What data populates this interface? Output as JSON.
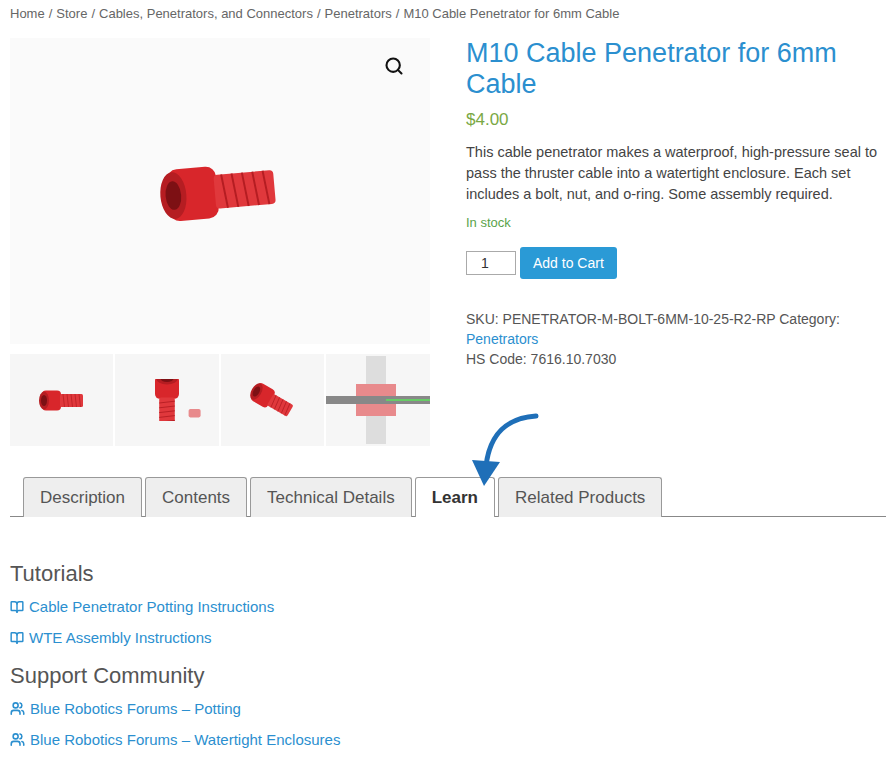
{
  "breadcrumb": {
    "separator": "/",
    "items": [
      "Home",
      "Store",
      "Cables, Penetrators, and Connectors",
      "Penetrators",
      "M10 Cable Penetrator for 6mm Cable"
    ]
  },
  "gallery": {
    "thumbnails": [
      {
        "kind": "bolt"
      },
      {
        "kind": "bolt-nut"
      },
      {
        "kind": "bolt-angle"
      },
      {
        "kind": "cross-section"
      }
    ]
  },
  "product": {
    "title": "M10 Cable Penetrator for 6mm Cable",
    "price": "$4.00",
    "description": "This cable penetrator makes a waterproof, high-pressure seal to pass the thruster cable into a watertight enclosure. Each set includes a bolt, nut, and o-ring. Some assembly required.",
    "stock": "In stock",
    "quantity": "1",
    "button": "Add to Cart",
    "sku_label": "SKU:",
    "sku": "PENETRATOR-M-BOLT-6MM-10-25-R2-RP",
    "category_label": "Category:",
    "category": "Penetrators",
    "hs_label": "HS Code:",
    "hs_code": "7616.10.7030"
  },
  "tabs": [
    {
      "label": "Description",
      "selected": false
    },
    {
      "label": "Contents",
      "selected": false
    },
    {
      "label": "Technical Details",
      "selected": false
    },
    {
      "label": "Learn",
      "selected": true
    },
    {
      "label": "Related Products",
      "selected": false
    }
  ],
  "sections": [
    {
      "heading": "Tutorials",
      "kind": "tutorial",
      "links": [
        "Cable Penetrator Potting Instructions",
        "WTE Assembly Instructions"
      ]
    },
    {
      "heading": "Support Community",
      "kind": "forum",
      "links": [
        "Blue Robotics Forums – Potting",
        "Blue Robotics Forums – Watertight Enclosures"
      ]
    }
  ]
}
